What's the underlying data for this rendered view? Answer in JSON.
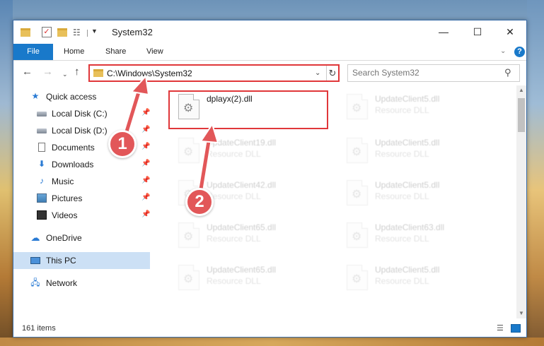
{
  "window": {
    "title": "System32",
    "controls": {
      "minimize": "—",
      "maximize": "☐",
      "close": "✕"
    }
  },
  "ribbon": {
    "tabs": [
      "File",
      "Home",
      "Share",
      "View"
    ]
  },
  "address": {
    "path": "C:\\Windows\\System32",
    "search_placeholder": "Search System32"
  },
  "sidebar": {
    "items": [
      {
        "label": "Quick access",
        "icon": "star-icon",
        "pinned": false
      },
      {
        "label": "Local Disk (C:)",
        "icon": "drive-icon",
        "pinned": true
      },
      {
        "label": "Local Disk (D:)",
        "icon": "drive-icon",
        "pinned": true
      },
      {
        "label": "Documents",
        "icon": "documents-icon",
        "pinned": true
      },
      {
        "label": "Downloads",
        "icon": "download-icon",
        "pinned": true
      },
      {
        "label": "Music",
        "icon": "music-icon",
        "pinned": true
      },
      {
        "label": "Pictures",
        "icon": "pictures-icon",
        "pinned": true
      },
      {
        "label": "Videos",
        "icon": "videos-icon",
        "pinned": true
      },
      {
        "label": "OneDrive",
        "icon": "onedrive-icon",
        "pinned": false
      },
      {
        "label": "This PC",
        "icon": "computer-icon",
        "pinned": false,
        "selected": true
      },
      {
        "label": "Network",
        "icon": "network-icon",
        "pinned": false
      }
    ]
  },
  "files": {
    "highlighted": {
      "name": "dplayx(2).dll",
      "type": ""
    },
    "items": [
      {
        "name": "UpdateClient5.dll",
        "type": "Resource DLL"
      },
      {
        "name": "UpdateClient19.dll",
        "type": "Resource DLL"
      },
      {
        "name": "UpdateClient5.dll",
        "type": "Resource DLL"
      },
      {
        "name": "UpdateClient42.dll",
        "type": "Resource DLL"
      },
      {
        "name": "UpdateClient5.dll",
        "type": "Resource DLL"
      },
      {
        "name": "UpdateClient65.dll",
        "type": "Resource DLL"
      },
      {
        "name": "UpdateClient63.dll",
        "type": "Resource DLL"
      },
      {
        "name": "UpdateClient65.dll",
        "type": "Resource DLL"
      },
      {
        "name": "UpdateClient5.dll",
        "type": "Resource DLL"
      }
    ]
  },
  "status": {
    "item_count": "161 items"
  },
  "callouts": {
    "step1": "1",
    "step2": "2",
    "color": "#e25759"
  },
  "colors": {
    "accent": "#1979ca",
    "highlight": "#e0373a",
    "selection": "#cce0f5"
  }
}
